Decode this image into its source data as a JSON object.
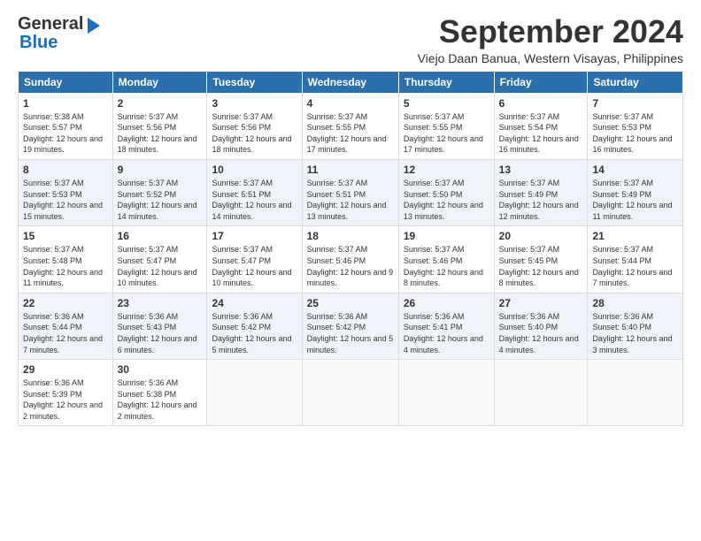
{
  "brand": {
    "name_part1": "General",
    "name_part2": "Blue"
  },
  "title": "September 2024",
  "subtitle": "Viejo Daan Banua, Western Visayas, Philippines",
  "days_of_week": [
    "Sunday",
    "Monday",
    "Tuesday",
    "Wednesday",
    "Thursday",
    "Friday",
    "Saturday"
  ],
  "weeks": [
    [
      {
        "day": "1",
        "sunrise": "5:38 AM",
        "sunset": "5:57 PM",
        "daylight": "12 hours and 19 minutes."
      },
      {
        "day": "2",
        "sunrise": "5:37 AM",
        "sunset": "5:56 PM",
        "daylight": "12 hours and 18 minutes."
      },
      {
        "day": "3",
        "sunrise": "5:37 AM",
        "sunset": "5:56 PM",
        "daylight": "12 hours and 18 minutes."
      },
      {
        "day": "4",
        "sunrise": "5:37 AM",
        "sunset": "5:55 PM",
        "daylight": "12 hours and 17 minutes."
      },
      {
        "day": "5",
        "sunrise": "5:37 AM",
        "sunset": "5:55 PM",
        "daylight": "12 hours and 17 minutes."
      },
      {
        "day": "6",
        "sunrise": "5:37 AM",
        "sunset": "5:54 PM",
        "daylight": "12 hours and 16 minutes."
      },
      {
        "day": "7",
        "sunrise": "5:37 AM",
        "sunset": "5:53 PM",
        "daylight": "12 hours and 16 minutes."
      }
    ],
    [
      {
        "day": "8",
        "sunrise": "5:37 AM",
        "sunset": "5:53 PM",
        "daylight": "12 hours and 15 minutes."
      },
      {
        "day": "9",
        "sunrise": "5:37 AM",
        "sunset": "5:52 PM",
        "daylight": "12 hours and 14 minutes."
      },
      {
        "day": "10",
        "sunrise": "5:37 AM",
        "sunset": "5:51 PM",
        "daylight": "12 hours and 14 minutes."
      },
      {
        "day": "11",
        "sunrise": "5:37 AM",
        "sunset": "5:51 PM",
        "daylight": "12 hours and 13 minutes."
      },
      {
        "day": "12",
        "sunrise": "5:37 AM",
        "sunset": "5:50 PM",
        "daylight": "12 hours and 13 minutes."
      },
      {
        "day": "13",
        "sunrise": "5:37 AM",
        "sunset": "5:49 PM",
        "daylight": "12 hours and 12 minutes."
      },
      {
        "day": "14",
        "sunrise": "5:37 AM",
        "sunset": "5:49 PM",
        "daylight": "12 hours and 11 minutes."
      }
    ],
    [
      {
        "day": "15",
        "sunrise": "5:37 AM",
        "sunset": "5:48 PM",
        "daylight": "12 hours and 11 minutes."
      },
      {
        "day": "16",
        "sunrise": "5:37 AM",
        "sunset": "5:47 PM",
        "daylight": "12 hours and 10 minutes."
      },
      {
        "day": "17",
        "sunrise": "5:37 AM",
        "sunset": "5:47 PM",
        "daylight": "12 hours and 10 minutes."
      },
      {
        "day": "18",
        "sunrise": "5:37 AM",
        "sunset": "5:46 PM",
        "daylight": "12 hours and 9 minutes."
      },
      {
        "day": "19",
        "sunrise": "5:37 AM",
        "sunset": "5:46 PM",
        "daylight": "12 hours and 8 minutes."
      },
      {
        "day": "20",
        "sunrise": "5:37 AM",
        "sunset": "5:45 PM",
        "daylight": "12 hours and 8 minutes."
      },
      {
        "day": "21",
        "sunrise": "5:37 AM",
        "sunset": "5:44 PM",
        "daylight": "12 hours and 7 minutes."
      }
    ],
    [
      {
        "day": "22",
        "sunrise": "5:36 AM",
        "sunset": "5:44 PM",
        "daylight": "12 hours and 7 minutes."
      },
      {
        "day": "23",
        "sunrise": "5:36 AM",
        "sunset": "5:43 PM",
        "daylight": "12 hours and 6 minutes."
      },
      {
        "day": "24",
        "sunrise": "5:36 AM",
        "sunset": "5:42 PM",
        "daylight": "12 hours and 5 minutes."
      },
      {
        "day": "25",
        "sunrise": "5:36 AM",
        "sunset": "5:42 PM",
        "daylight": "12 hours and 5 minutes."
      },
      {
        "day": "26",
        "sunrise": "5:36 AM",
        "sunset": "5:41 PM",
        "daylight": "12 hours and 4 minutes."
      },
      {
        "day": "27",
        "sunrise": "5:36 AM",
        "sunset": "5:40 PM",
        "daylight": "12 hours and 4 minutes."
      },
      {
        "day": "28",
        "sunrise": "5:36 AM",
        "sunset": "5:40 PM",
        "daylight": "12 hours and 3 minutes."
      }
    ],
    [
      {
        "day": "29",
        "sunrise": "5:36 AM",
        "sunset": "5:39 PM",
        "daylight": "12 hours and 2 minutes."
      },
      {
        "day": "30",
        "sunrise": "5:36 AM",
        "sunset": "5:38 PM",
        "daylight": "12 hours and 2 minutes."
      },
      null,
      null,
      null,
      null,
      null
    ]
  ],
  "labels": {
    "sunrise": "Sunrise:",
    "sunset": "Sunset:",
    "daylight": "Daylight:"
  }
}
